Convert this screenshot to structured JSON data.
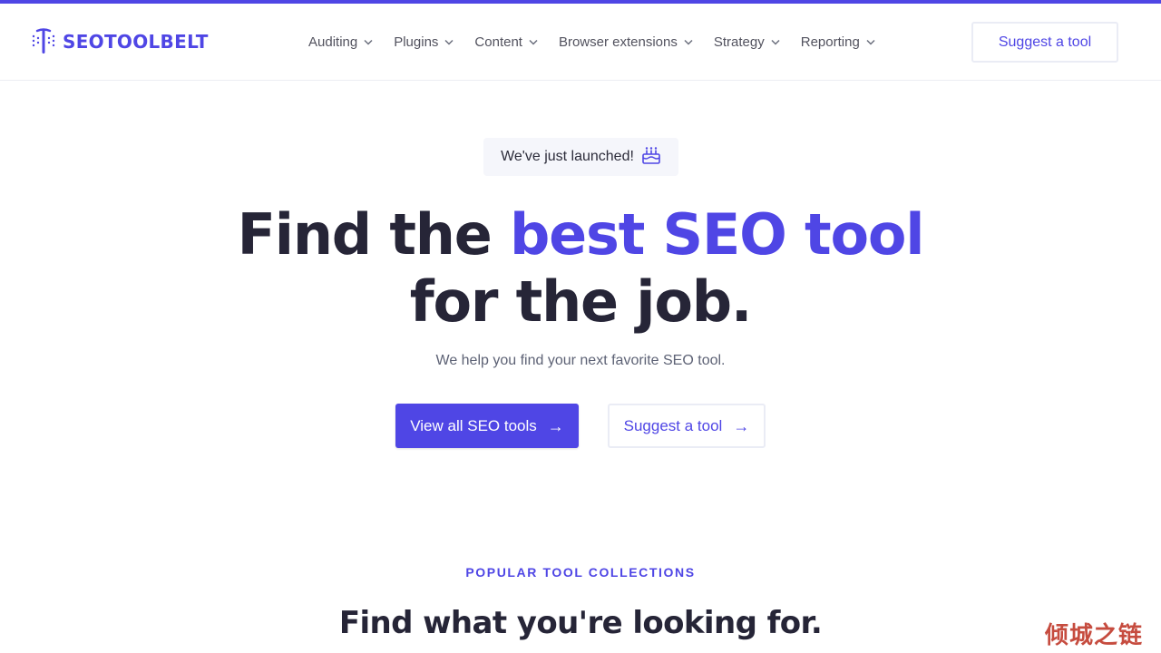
{
  "brand": {
    "name": "SEOTOOLBELT",
    "accent_color": "#4f46e5",
    "logo_icon": "tool-belt-icon"
  },
  "nav": {
    "items": [
      {
        "label": "Auditing"
      },
      {
        "label": "Plugins"
      },
      {
        "label": "Content"
      },
      {
        "label": "Browser extensions"
      },
      {
        "label": "Strategy"
      },
      {
        "label": "Reporting"
      }
    ],
    "cta_label": "Suggest a tool"
  },
  "hero": {
    "badge_text": "We've just launched!",
    "badge_icon": "birthday-cake-icon",
    "title_part1": "Find the ",
    "title_accent": "best SEO tool",
    "title_part2": "for the job.",
    "subtitle": "We help you find your next favorite SEO tool.",
    "primary_button": "View all SEO tools",
    "secondary_button": "Suggest a tool"
  },
  "collections": {
    "eyebrow": "POPULAR TOOL COLLECTIONS",
    "title": "Find what you're looking for."
  },
  "watermark": {
    "text": "倾城之链"
  }
}
